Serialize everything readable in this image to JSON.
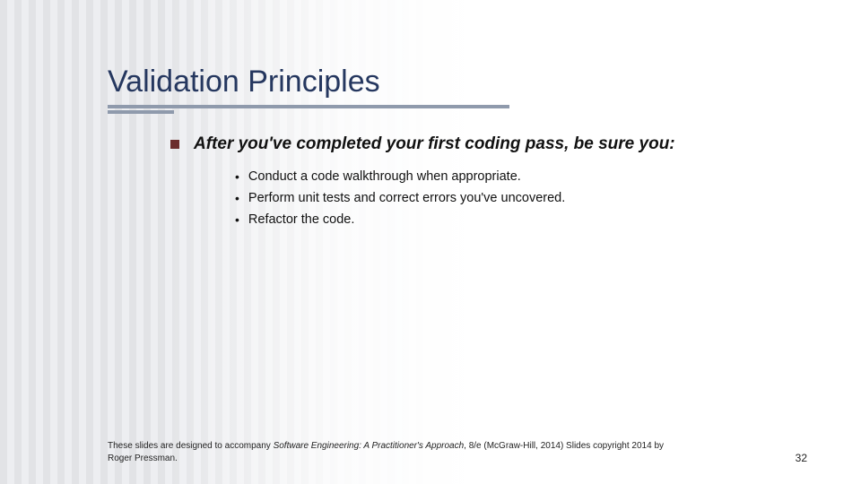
{
  "title": "Validation Principles",
  "main_bullet": {
    "text": "After you've completed your first coding pass, be sure you:"
  },
  "sub_bullets": [
    "Conduct a code walkthrough when appropriate.",
    "Perform unit tests and correct errors you've uncovered.",
    "Refactor the code."
  ],
  "footer": {
    "prefix": "These slides are designed to accompany ",
    "italic": "Software Engineering: A Practitioner's Approach",
    "suffix": ", 8/e (McGraw-Hill, 2014) Slides copyright 2014 by Roger Pressman."
  },
  "page_number": "32"
}
